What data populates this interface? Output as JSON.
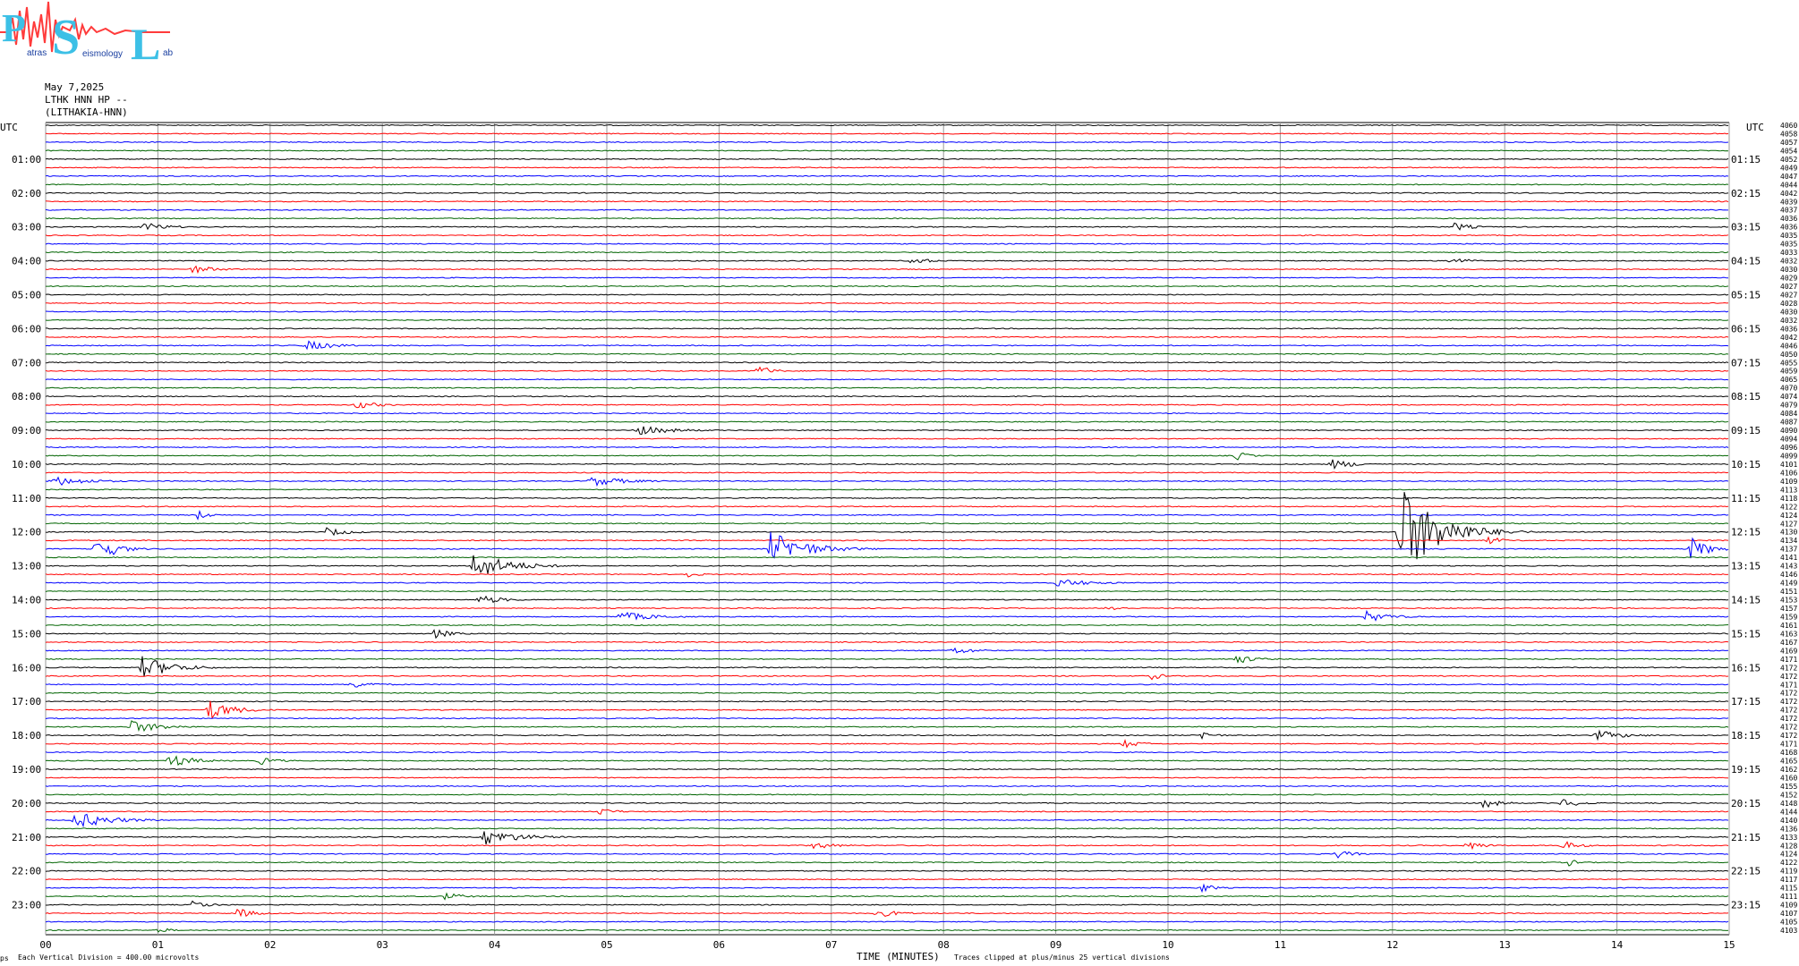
{
  "logo": {
    "letters": [
      "P",
      "S",
      "L"
    ],
    "sub_words": [
      "atras",
      "eismology",
      "ab"
    ],
    "colors": {
      "letters": "#3cc0e6",
      "wave": "#ff3b3b"
    }
  },
  "header": {
    "date": "May 7,2025",
    "station": "LTHK HNN HP --",
    "site": "(LITHAKIA-HNN)"
  },
  "footer": {
    "scale_note": "Each Vertical Division =  400.00 microvolts",
    "xlabel": "TIME (MINUTES)",
    "clip_note": "Traces clipped at plus/minus 25 vertical divisions",
    "corner_mark": "ps"
  },
  "chart_data": {
    "type": "line",
    "title": "",
    "xlabel": "TIME (MINUTES)",
    "x_ticks": [
      "00",
      "01",
      "02",
      "03",
      "04",
      "05",
      "06",
      "07",
      "08",
      "09",
      "10",
      "11",
      "12",
      "13",
      "14",
      "15"
    ],
    "xlim": [
      0,
      15
    ],
    "tz_label_left": "UTC",
    "tz_label_right": "UTC",
    "trace_colors": [
      "#000000",
      "#ff0000",
      "#0000ff",
      "#006400"
    ],
    "hour_labels_left": [
      "01:00",
      "02:00",
      "03:00",
      "04:00",
      "05:00",
      "06:00",
      "07:00",
      "08:00",
      "09:00",
      "10:00",
      "11:00",
      "12:00",
      "13:00",
      "14:00",
      "15:00",
      "16:00",
      "17:00",
      "18:00",
      "19:00",
      "20:00",
      "21:00",
      "22:00",
      "23:00"
    ],
    "hour_labels_right": [
      "01:15",
      "02:15",
      "03:15",
      "04:15",
      "05:15",
      "06:15",
      "07:15",
      "08:15",
      "09:15",
      "10:15",
      "11:15",
      "12:15",
      "13:15",
      "14:15",
      "15:15",
      "16:15",
      "17:15",
      "18:15",
      "19:15",
      "20:15",
      "21:15",
      "22:15",
      "23:15"
    ],
    "trace_values": [
      "4060",
      "4058",
      "4057",
      "4054",
      "4052",
      "4049",
      "4047",
      "4044",
      "4042",
      "4039",
      "4037",
      "4036",
      "4036",
      "4035",
      "4035",
      "4033",
      "4032",
      "4030",
      "4029",
      "4027",
      "4027",
      "4028",
      "4030",
      "4032",
      "4036",
      "4042",
      "4046",
      "4050",
      "4055",
      "4059",
      "4065",
      "4070",
      "4074",
      "4079",
      "4084",
      "4087",
      "4090",
      "4094",
      "4096",
      "4099",
      "4101",
      "4106",
      "4109",
      "4113",
      "4118",
      "4122",
      "4124",
      "4127",
      "4130",
      "4134",
      "4137",
      "4141",
      "4143",
      "4146",
      "4149",
      "4151",
      "4153",
      "4157",
      "4159",
      "4161",
      "4163",
      "4167",
      "4169",
      "4171",
      "4172",
      "4172",
      "4171",
      "4172",
      "4172",
      "4172",
      "4172",
      "4172",
      "4172",
      "4171",
      "4168",
      "4165",
      "4162",
      "4160",
      "4155",
      "4152",
      "4148",
      "4144",
      "4140",
      "4136",
      "4133",
      "4128",
      "4124",
      "4122",
      "4119",
      "4117",
      "4115",
      "4111",
      "4109",
      "4107",
      "4105",
      "4103"
    ],
    "events": [
      {
        "trace": 12,
        "minute": 0.85,
        "amp": 6,
        "dur": 0.2
      },
      {
        "trace": 12,
        "minute": 12.55,
        "amp": 5,
        "dur": 0.15
      },
      {
        "trace": 16,
        "minute": 12.5,
        "amp": 5,
        "dur": 0.15
      },
      {
        "trace": 16,
        "minute": 7.7,
        "amp": 5,
        "dur": 0.15
      },
      {
        "trace": 17,
        "minute": 1.3,
        "amp": 5,
        "dur": 0.2
      },
      {
        "trace": 26,
        "minute": 2.3,
        "amp": 6,
        "dur": 0.25
      },
      {
        "trace": 29,
        "minute": 6.35,
        "amp": 8,
        "dur": 0.1
      },
      {
        "trace": 33,
        "minute": 2.75,
        "amp": 5,
        "dur": 0.2
      },
      {
        "trace": 36,
        "minute": 5.25,
        "amp": 6,
        "dur": 0.3
      },
      {
        "trace": 39,
        "minute": 10.6,
        "amp": 6,
        "dur": 0.1
      },
      {
        "trace": 40,
        "minute": 11.45,
        "amp": 6,
        "dur": 0.2
      },
      {
        "trace": 42,
        "minute": 0.05,
        "amp": 6,
        "dur": 0.3
      },
      {
        "trace": 42,
        "minute": 4.85,
        "amp": 6,
        "dur": 0.3
      },
      {
        "trace": 46,
        "minute": 1.35,
        "amp": 6,
        "dur": 0.1
      },
      {
        "trace": 48,
        "minute": 12.05,
        "amp": 60,
        "dur": 0.3
      },
      {
        "trace": 48,
        "minute": 2.5,
        "amp": 5,
        "dur": 0.2
      },
      {
        "trace": 49,
        "minute": 12.85,
        "amp": 6,
        "dur": 0.1
      },
      {
        "trace": 50,
        "minute": 0.45,
        "amp": 18,
        "dur": 0.15
      },
      {
        "trace": 50,
        "minute": 6.45,
        "amp": 20,
        "dur": 0.3
      },
      {
        "trace": 50,
        "minute": 14.65,
        "amp": 14,
        "dur": 0.15
      },
      {
        "trace": 52,
        "minute": 3.8,
        "amp": 16,
        "dur": 0.3
      },
      {
        "trace": 53,
        "minute": 5.7,
        "amp": 5,
        "dur": 0.1
      },
      {
        "trace": 54,
        "minute": 9.0,
        "amp": 5,
        "dur": 0.3
      },
      {
        "trace": 56,
        "minute": 3.85,
        "amp": 6,
        "dur": 0.2
      },
      {
        "trace": 57,
        "minute": 9.45,
        "amp": 5,
        "dur": 0.1
      },
      {
        "trace": 58,
        "minute": 5.1,
        "amp": 6,
        "dur": 0.3
      },
      {
        "trace": 58,
        "minute": 11.75,
        "amp": 7,
        "dur": 0.2
      },
      {
        "trace": 60,
        "minute": 3.45,
        "amp": 6,
        "dur": 0.15
      },
      {
        "trace": 62,
        "minute": 8.05,
        "amp": 5,
        "dur": 0.2
      },
      {
        "trace": 63,
        "minute": 10.6,
        "amp": 6,
        "dur": 0.15
      },
      {
        "trace": 64,
        "minute": 0.85,
        "amp": 14,
        "dur": 0.25
      },
      {
        "trace": 65,
        "minute": 9.85,
        "amp": 5,
        "dur": 0.1
      },
      {
        "trace": 66,
        "minute": 2.7,
        "amp": 5,
        "dur": 0.2
      },
      {
        "trace": 69,
        "minute": 1.45,
        "amp": 12,
        "dur": 0.2
      },
      {
        "trace": 71,
        "minute": 0.75,
        "amp": 8,
        "dur": 0.25
      },
      {
        "trace": 72,
        "minute": 10.3,
        "amp": 6,
        "dur": 0.1
      },
      {
        "trace": 72,
        "minute": 13.8,
        "amp": 6,
        "dur": 0.25
      },
      {
        "trace": 73,
        "minute": 9.6,
        "amp": 5,
        "dur": 0.15
      },
      {
        "trace": 75,
        "minute": 1.1,
        "amp": 8,
        "dur": 0.2
      },
      {
        "trace": 75,
        "minute": 1.9,
        "amp": 5,
        "dur": 0.15
      },
      {
        "trace": 80,
        "minute": 12.8,
        "amp": 6,
        "dur": 0.15
      },
      {
        "trace": 80,
        "minute": 13.5,
        "amp": 6,
        "dur": 0.15
      },
      {
        "trace": 81,
        "minute": 4.9,
        "amp": 5,
        "dur": 0.15
      },
      {
        "trace": 82,
        "minute": 0.25,
        "amp": 10,
        "dur": 0.3
      },
      {
        "trace": 84,
        "minute": 3.9,
        "amp": 9,
        "dur": 0.3
      },
      {
        "trace": 85,
        "minute": 6.8,
        "amp": 5,
        "dur": 0.2
      },
      {
        "trace": 85,
        "minute": 12.65,
        "amp": 6,
        "dur": 0.15
      },
      {
        "trace": 85,
        "minute": 13.5,
        "amp": 6,
        "dur": 0.15
      },
      {
        "trace": 86,
        "minute": 11.5,
        "amp": 5,
        "dur": 0.15
      },
      {
        "trace": 87,
        "minute": 13.55,
        "amp": 5,
        "dur": 0.1
      },
      {
        "trace": 90,
        "minute": 10.3,
        "amp": 6,
        "dur": 0.1
      },
      {
        "trace": 91,
        "minute": 3.55,
        "amp": 5,
        "dur": 0.15
      },
      {
        "trace": 92,
        "minute": 1.3,
        "amp": 5,
        "dur": 0.15
      },
      {
        "trace": 93,
        "minute": 1.7,
        "amp": 6,
        "dur": 0.15
      },
      {
        "trace": 93,
        "minute": 7.4,
        "amp": 5,
        "dur": 0.2
      },
      {
        "trace": 95,
        "minute": 1.0,
        "amp": 4,
        "dur": 0.1
      },
      {
        "trace": 99,
        "minute": 6.4,
        "amp": 5,
        "dur": 0.2
      }
    ]
  }
}
